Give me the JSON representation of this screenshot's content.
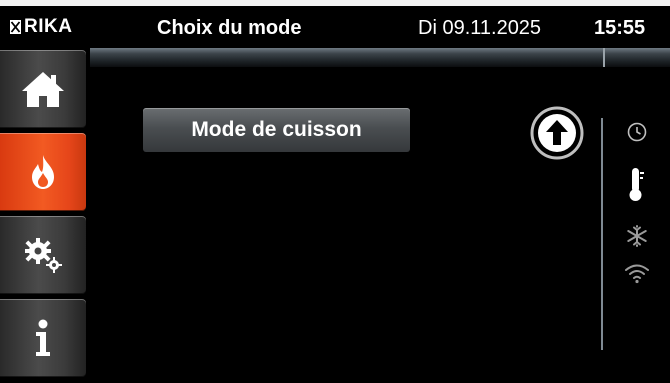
{
  "header": {
    "brand": "RIKA",
    "title": "Choix du mode",
    "date": "Di 09.11.2025",
    "time": "15:55"
  },
  "sidebar": {
    "items": [
      {
        "name": "home",
        "icon": "home-icon",
        "active": false
      },
      {
        "name": "flame",
        "icon": "flame-icon",
        "active": true
      },
      {
        "name": "settings",
        "icon": "gears-icon",
        "active": false
      },
      {
        "name": "info",
        "icon": "info-icon",
        "active": false
      }
    ]
  },
  "main": {
    "mode_label": "Mode de cuisson",
    "up_button_icon": "arrow-up-circle-icon"
  },
  "status": {
    "icons": [
      "clock-icon",
      "thermometer-icon",
      "snowflake-icon",
      "wifi-icon"
    ]
  },
  "colors": {
    "accent": "#f25a22",
    "sidebar_button": "#4b4b4b",
    "mode_button": "#4a4e51"
  }
}
